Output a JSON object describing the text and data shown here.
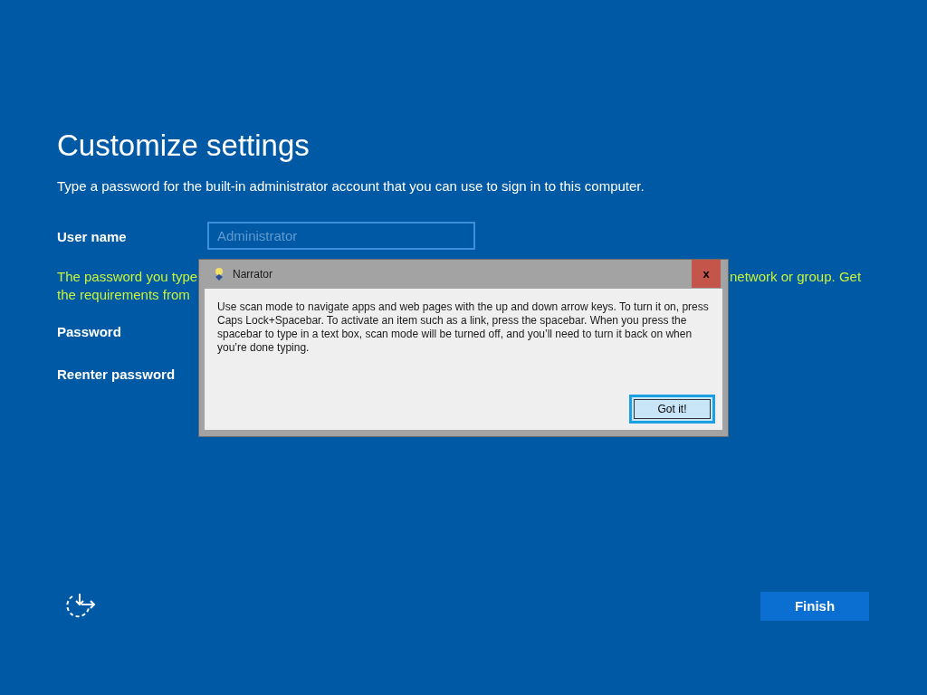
{
  "page": {
    "title": "Customize settings",
    "description": "Type a password for the built-in administrator account that you can use to sign in to this computer.",
    "fields": [
      {
        "label": "User name",
        "placeholder": "Administrator"
      },
      {
        "label": "Password"
      },
      {
        "label": "Reenter password"
      }
    ],
    "notice": {
      "line_1_left": "The password you type",
      "line_1_right": "network or group. Get",
      "line_2_left": "the requirements from"
    },
    "finish_button": "Finish"
  },
  "dialog": {
    "title": "Narrator",
    "close": "x",
    "message": "Use scan mode to navigate apps and web pages with the up and down arrow keys. To turn it on, press Caps Lock+Spacebar. To activate an item such as a link, press the spacebar. When you press the spacebar to type in a text box, scan mode will be turned off, and you’ll need to turn it back on when you’re done typing.",
    "button": "Got it!"
  }
}
